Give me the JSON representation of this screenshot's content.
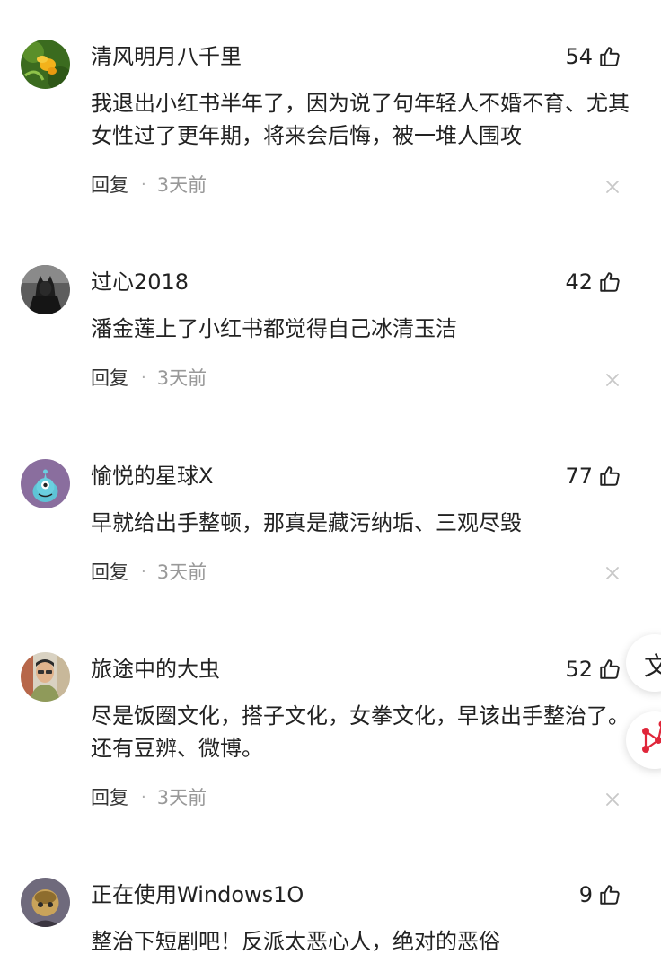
{
  "comments": [
    {
      "username": "清风明月八千里",
      "likes": "54",
      "text": "我退出小红书半年了，因为说了句年轻人不婚不育、尤其女性过了更年期，将来会后悔，被一堆人围攻",
      "reply_label": "回复",
      "separator": "·",
      "time": "3天前"
    },
    {
      "username": "过心2018",
      "likes": "42",
      "text": "潘金莲上了小红书都觉得自己冰清玉洁",
      "reply_label": "回复",
      "separator": "·",
      "time": "3天前"
    },
    {
      "username": "愉悦的星球X",
      "likes": "77",
      "text": "早就给出手整顿，那真是藏污纳垢、三观尽毁",
      "reply_label": "回复",
      "separator": "·",
      "time": "3天前"
    },
    {
      "username": "旅途中的大虫",
      "likes": "52",
      "text": "尽是饭圈文化，搭子文化，女拳文化，早该出手整治了。还有豆辨、微博。",
      "reply_label": "回复",
      "separator": "·",
      "time": "3天前"
    },
    {
      "username": "正在使用Windows1O",
      "likes": "9",
      "text": "整治下短剧吧！反派太恶心人，绝对的恶俗"
    }
  ],
  "floating_buttons": {
    "top_glyph": "文"
  },
  "colors": {
    "text": "#222222",
    "meta_time": "#999999",
    "close": "#c8c8c8",
    "float_icon": "#e0263a"
  }
}
